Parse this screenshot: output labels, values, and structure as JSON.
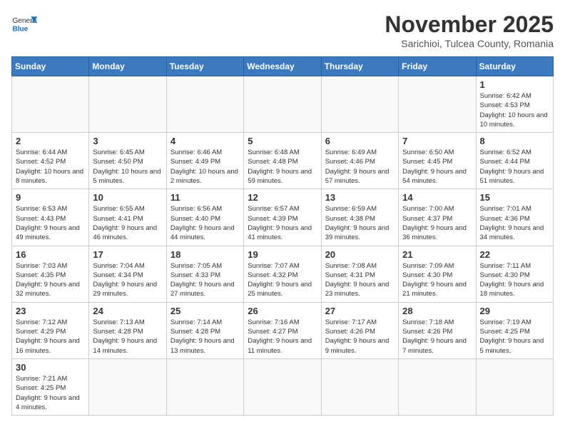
{
  "logo": {
    "text_general": "General",
    "text_blue": "Blue"
  },
  "header": {
    "month": "November 2025",
    "location": "Sarichioi, Tulcea County, Romania"
  },
  "weekdays": [
    "Sunday",
    "Monday",
    "Tuesday",
    "Wednesday",
    "Thursday",
    "Friday",
    "Saturday"
  ],
  "weeks": [
    [
      {
        "day": "",
        "info": ""
      },
      {
        "day": "",
        "info": ""
      },
      {
        "day": "",
        "info": ""
      },
      {
        "day": "",
        "info": ""
      },
      {
        "day": "",
        "info": ""
      },
      {
        "day": "",
        "info": ""
      },
      {
        "day": "1",
        "info": "Sunrise: 6:42 AM\nSunset: 4:53 PM\nDaylight: 10 hours and 10 minutes."
      }
    ],
    [
      {
        "day": "2",
        "info": "Sunrise: 6:44 AM\nSunset: 4:52 PM\nDaylight: 10 hours and 8 minutes."
      },
      {
        "day": "3",
        "info": "Sunrise: 6:45 AM\nSunset: 4:50 PM\nDaylight: 10 hours and 5 minutes."
      },
      {
        "day": "4",
        "info": "Sunrise: 6:46 AM\nSunset: 4:49 PM\nDaylight: 10 hours and 2 minutes."
      },
      {
        "day": "5",
        "info": "Sunrise: 6:48 AM\nSunset: 4:48 PM\nDaylight: 9 hours and 59 minutes."
      },
      {
        "day": "6",
        "info": "Sunrise: 6:49 AM\nSunset: 4:46 PM\nDaylight: 9 hours and 57 minutes."
      },
      {
        "day": "7",
        "info": "Sunrise: 6:50 AM\nSunset: 4:45 PM\nDaylight: 9 hours and 54 minutes."
      },
      {
        "day": "8",
        "info": "Sunrise: 6:52 AM\nSunset: 4:44 PM\nDaylight: 9 hours and 51 minutes."
      }
    ],
    [
      {
        "day": "9",
        "info": "Sunrise: 6:53 AM\nSunset: 4:43 PM\nDaylight: 9 hours and 49 minutes."
      },
      {
        "day": "10",
        "info": "Sunrise: 6:55 AM\nSunset: 4:41 PM\nDaylight: 9 hours and 46 minutes."
      },
      {
        "day": "11",
        "info": "Sunrise: 6:56 AM\nSunset: 4:40 PM\nDaylight: 9 hours and 44 minutes."
      },
      {
        "day": "12",
        "info": "Sunrise: 6:57 AM\nSunset: 4:39 PM\nDaylight: 9 hours and 41 minutes."
      },
      {
        "day": "13",
        "info": "Sunrise: 6:59 AM\nSunset: 4:38 PM\nDaylight: 9 hours and 39 minutes."
      },
      {
        "day": "14",
        "info": "Sunrise: 7:00 AM\nSunset: 4:37 PM\nDaylight: 9 hours and 36 minutes."
      },
      {
        "day": "15",
        "info": "Sunrise: 7:01 AM\nSunset: 4:36 PM\nDaylight: 9 hours and 34 minutes."
      }
    ],
    [
      {
        "day": "16",
        "info": "Sunrise: 7:03 AM\nSunset: 4:35 PM\nDaylight: 9 hours and 32 minutes."
      },
      {
        "day": "17",
        "info": "Sunrise: 7:04 AM\nSunset: 4:34 PM\nDaylight: 9 hours and 29 minutes."
      },
      {
        "day": "18",
        "info": "Sunrise: 7:05 AM\nSunset: 4:33 PM\nDaylight: 9 hours and 27 minutes."
      },
      {
        "day": "19",
        "info": "Sunrise: 7:07 AM\nSunset: 4:32 PM\nDaylight: 9 hours and 25 minutes."
      },
      {
        "day": "20",
        "info": "Sunrise: 7:08 AM\nSunset: 4:31 PM\nDaylight: 9 hours and 23 minutes."
      },
      {
        "day": "21",
        "info": "Sunrise: 7:09 AM\nSunset: 4:30 PM\nDaylight: 9 hours and 21 minutes."
      },
      {
        "day": "22",
        "info": "Sunrise: 7:11 AM\nSunset: 4:30 PM\nDaylight: 9 hours and 18 minutes."
      }
    ],
    [
      {
        "day": "23",
        "info": "Sunrise: 7:12 AM\nSunset: 4:29 PM\nDaylight: 9 hours and 16 minutes."
      },
      {
        "day": "24",
        "info": "Sunrise: 7:13 AM\nSunset: 4:28 PM\nDaylight: 9 hours and 14 minutes."
      },
      {
        "day": "25",
        "info": "Sunrise: 7:14 AM\nSunset: 4:28 PM\nDaylight: 9 hours and 13 minutes."
      },
      {
        "day": "26",
        "info": "Sunrise: 7:16 AM\nSunset: 4:27 PM\nDaylight: 9 hours and 11 minutes."
      },
      {
        "day": "27",
        "info": "Sunrise: 7:17 AM\nSunset: 4:26 PM\nDaylight: 9 hours and 9 minutes."
      },
      {
        "day": "28",
        "info": "Sunrise: 7:18 AM\nSunset: 4:26 PM\nDaylight: 9 hours and 7 minutes."
      },
      {
        "day": "29",
        "info": "Sunrise: 7:19 AM\nSunset: 4:25 PM\nDaylight: 9 hours and 5 minutes."
      }
    ],
    [
      {
        "day": "30",
        "info": "Sunrise: 7:21 AM\nSunset: 4:25 PM\nDaylight: 9 hours and 4 minutes."
      },
      {
        "day": "",
        "info": ""
      },
      {
        "day": "",
        "info": ""
      },
      {
        "day": "",
        "info": ""
      },
      {
        "day": "",
        "info": ""
      },
      {
        "day": "",
        "info": ""
      },
      {
        "day": "",
        "info": ""
      }
    ]
  ]
}
